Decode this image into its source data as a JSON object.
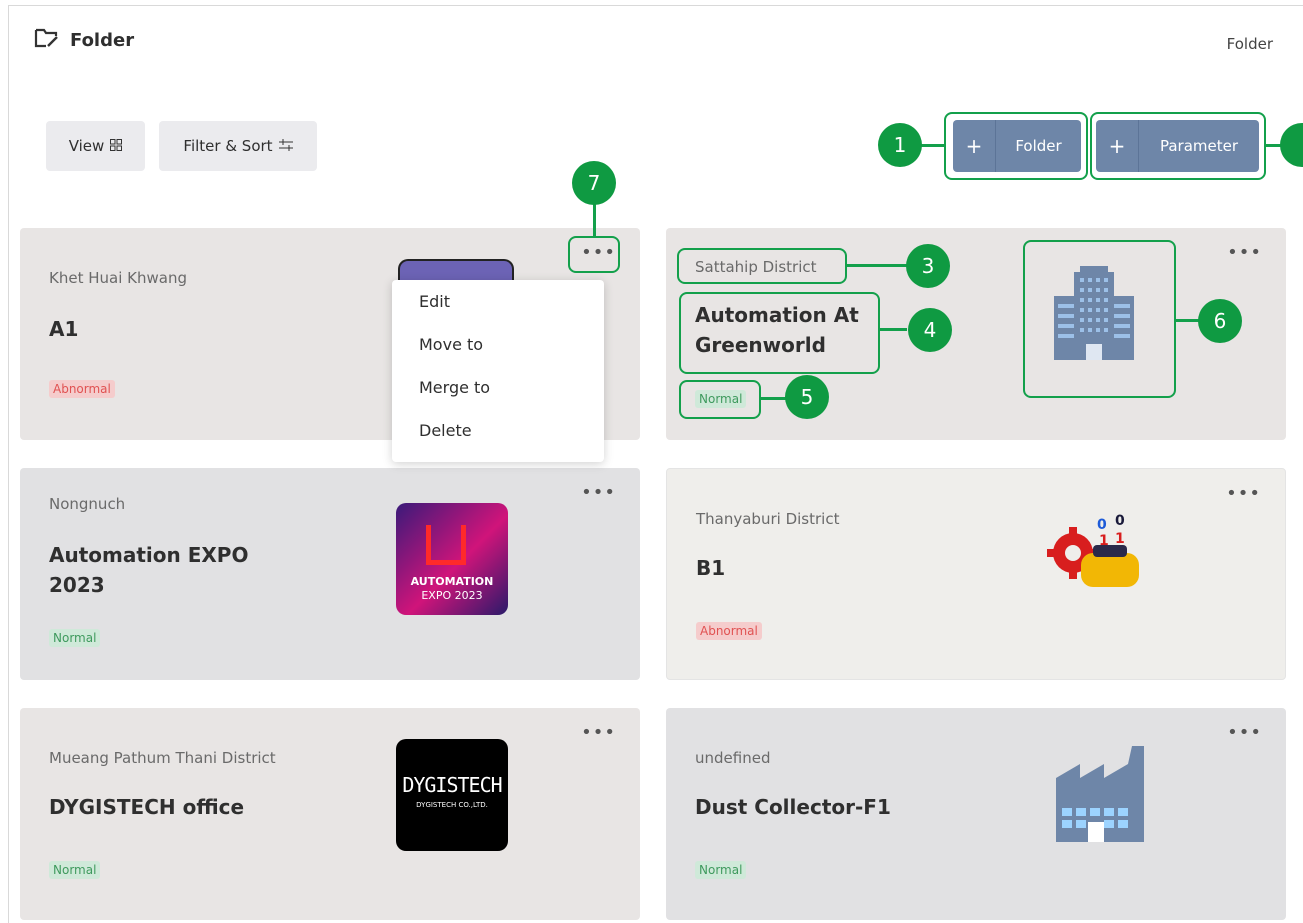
{
  "header": {
    "title": "Folder",
    "breadcrumb": "Folder"
  },
  "toolbar": {
    "view_label": "View",
    "filter_label": "Filter & Sort",
    "add_folder_label": "Folder",
    "add_parameter_label": "Parameter",
    "plus": "+"
  },
  "callouts": [
    "1",
    "3",
    "4",
    "5",
    "6",
    "7"
  ],
  "menu": {
    "items": [
      "Edit",
      "Move to",
      "Merge to",
      "Delete"
    ]
  },
  "cards": [
    {
      "location": "Khet Huai Khwang",
      "name": "A1",
      "status": "Abnormal"
    },
    {
      "location": "Sattahip District",
      "name": "Automation At Greenworld",
      "status": "Normal"
    },
    {
      "location": "Nongnuch",
      "name": "Automation EXPO 2023",
      "status": "Normal"
    },
    {
      "location": "Thanyaburi District",
      "name": "B1",
      "status": "Abnormal"
    },
    {
      "location": "Mueang Pathum Thani District",
      "name": "DYGISTECH office",
      "status": "Normal"
    },
    {
      "location": "undefined",
      "name": "Dust Collector-F1",
      "status": "Normal"
    }
  ],
  "thumbs": {
    "expo_word": "AUTOMATION",
    "expo_sub": "EXPO 2023",
    "dygis_word": "DYGISTECH",
    "dygis_sub": "DYGISTECH CO.,LTD."
  },
  "colors": {
    "accent": "#6e86a8",
    "callout": "#0f9a42",
    "normal": "#3f9a5e",
    "abnormal": "#e05252"
  }
}
